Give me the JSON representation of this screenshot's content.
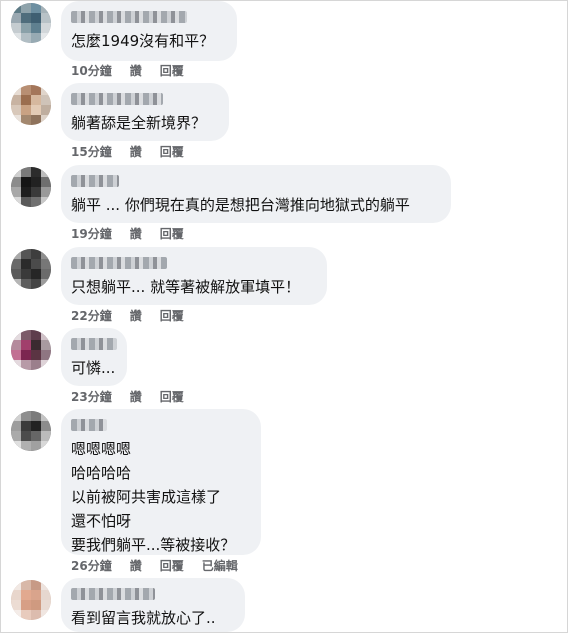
{
  "comments": [
    {
      "text": "怎麼1949沒有和平？",
      "time": "10分鐘",
      "like": "讚",
      "reply": "回覆",
      "edited": ""
    },
    {
      "text": "躺著舔是全新境界？",
      "time": "15分鐘",
      "like": "讚",
      "reply": "回覆",
      "edited": ""
    },
    {
      "text": "躺平 ... 你們現在真的是想把台灣推向地獄式的躺平",
      "time": "19分鐘",
      "like": "讚",
      "reply": "回覆",
      "edited": ""
    },
    {
      "text": "只想躺平... 就等著被解放軍填平！",
      "time": "22分鐘",
      "like": "讚",
      "reply": "回覆",
      "edited": ""
    },
    {
      "text": "可憐...",
      "time": "23分鐘",
      "like": "讚",
      "reply": "回覆",
      "edited": ""
    },
    {
      "text": "嗯嗯嗯嗯\n哈哈哈哈\n以前被阿共害成這樣了\n還不怕呀\n要我們躺平...等被接收？",
      "time": "26分鐘",
      "like": "讚",
      "reply": "回覆",
      "edited": "已編輯"
    },
    {
      "text": "看到留言我就放心了..",
      "time": "",
      "like": "",
      "reply": "",
      "edited": ""
    }
  ],
  "colors": {
    "bubble": "#eff1f4",
    "action_text": "#65676b",
    "comment_text": "#111111"
  },
  "icons": [
    "avatar-pixelated",
    "name-pixelated"
  ]
}
